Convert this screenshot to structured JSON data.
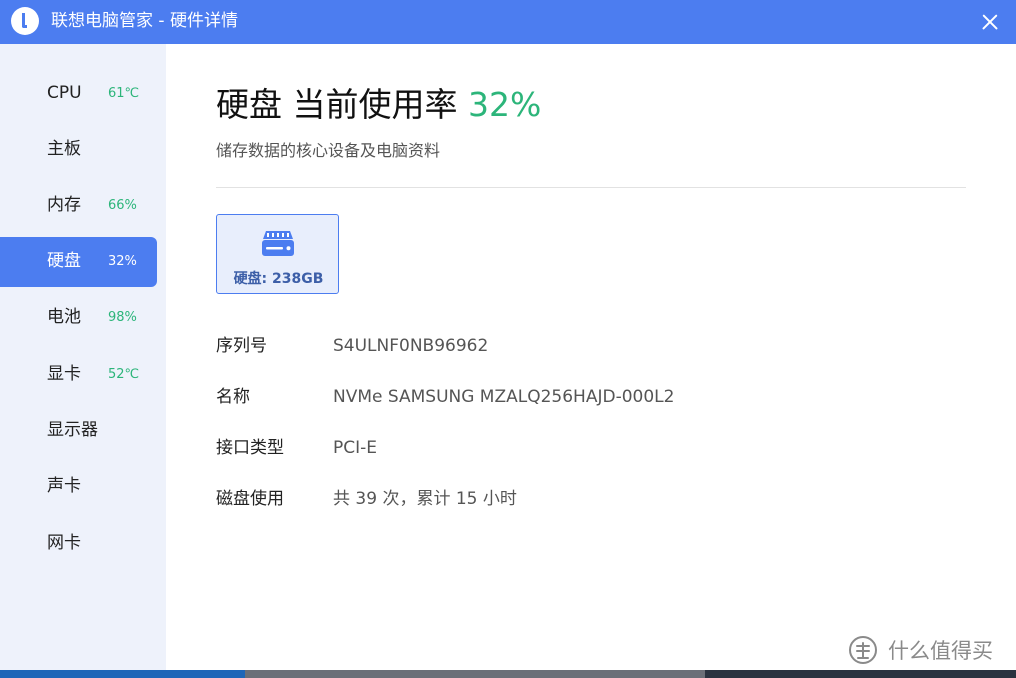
{
  "window": {
    "title": "联想电脑管家 - 硬件详情"
  },
  "sidebar": {
    "items": [
      {
        "label": "CPU",
        "value": "61℃"
      },
      {
        "label": "主板",
        "value": ""
      },
      {
        "label": "内存",
        "value": "66%"
      },
      {
        "label": "硬盘",
        "value": "32%",
        "active": true
      },
      {
        "label": "电池",
        "value": "98%"
      },
      {
        "label": "显卡",
        "value": "52℃"
      },
      {
        "label": "显示器",
        "value": ""
      },
      {
        "label": "声卡",
        "value": ""
      },
      {
        "label": "网卡",
        "value": ""
      }
    ]
  },
  "main": {
    "title": "硬盘 当前使用率",
    "usage": "32%",
    "subtitle": "储存数据的核心设备及电脑资料",
    "disk_card": {
      "label": "硬盘: 238GB",
      "icon": "hard-drive-icon"
    },
    "details": [
      {
        "label": "序列号",
        "value": "S4ULNF0NB96962"
      },
      {
        "label": "名称",
        "value": "NVMe SAMSUNG MZALQ256HAJD-000L2"
      },
      {
        "label": "接口类型",
        "value": "PCI-E"
      },
      {
        "label": "磁盘使用",
        "value": "共 39 次，累计 15 小时"
      }
    ]
  },
  "watermark": {
    "text": "什么值得买",
    "icon": "smzdm-logo"
  },
  "colors": {
    "accent": "#4c7df0",
    "success": "#2cb57a",
    "sidebar_bg": "#eef2fb"
  }
}
